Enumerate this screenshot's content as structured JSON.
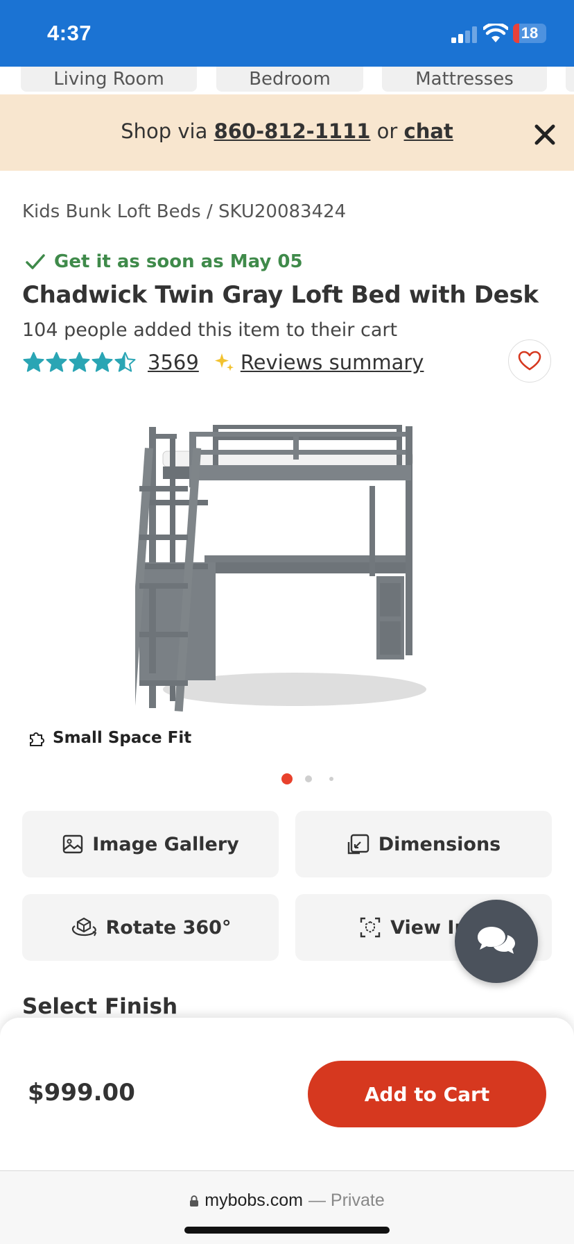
{
  "status_bar": {
    "time": "4:37",
    "battery_level": "18",
    "battery_fraction": 0.18
  },
  "category_tabs": [
    {
      "label": "Living Room"
    },
    {
      "label": "Bedroom"
    },
    {
      "label": "Mattresses"
    }
  ],
  "promo": {
    "prefix": "Shop via ",
    "phone": "860-812-1111",
    "middle": " or ",
    "chat": "chat"
  },
  "breadcrumb": {
    "category": "Kids Bunk Loft Beds",
    "separator": "/",
    "sku": "SKU20083424"
  },
  "product": {
    "delivery": "Get it as soon as May 05",
    "title": "Chadwick Twin Gray Loft Bed with Desk",
    "cart_count_text": "104 people added this item to their cart",
    "rating": 4.5,
    "review_count": "3569",
    "reviews_summary_label": "Reviews summary",
    "badge": "Small Space Fit",
    "image_count": 3,
    "active_image": 1
  },
  "actions": {
    "image_gallery": "Image Gallery",
    "dimensions": "Dimensions",
    "rotate": "Rotate 360°",
    "view_in_room": "View In R"
  },
  "select_finish": "Select Finish",
  "cart": {
    "price": "$999.00",
    "add_to_cart": "Add to Cart"
  },
  "browser": {
    "domain": "mybobs.com",
    "mode": "— Private"
  },
  "colors": {
    "status_bar": "#1b73d3",
    "promo_bg": "#f8e6cf",
    "accent_red": "#d6381f",
    "star": "#2aa5b4",
    "delivery_green": "#3f8a4a",
    "heart": "#d6381f"
  }
}
